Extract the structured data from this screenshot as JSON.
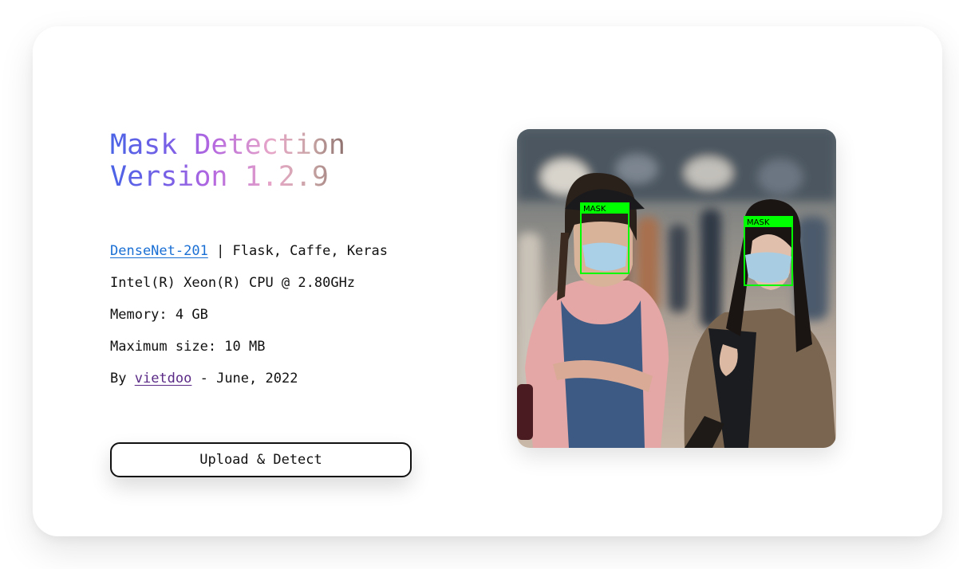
{
  "header": {
    "title_line1": "Mask Detection",
    "title_line2": "Version 1.2.9"
  },
  "specs": {
    "model_link": "DenseNet-201",
    "frameworks": " | Flask, Caffe, Keras",
    "cpu": "Intel(R) Xeon(R) CPU @ 2.80GHz",
    "memory": "Memory: 4 GB",
    "max_size": "Maximum size: 10 MB",
    "by_prefix": "By ",
    "author": "vietdoo",
    "date_suffix": " - June, 2022"
  },
  "actions": {
    "upload_label": "Upload & Detect"
  },
  "detections": [
    {
      "label": "MASK"
    },
    {
      "label": "MASK"
    }
  ],
  "colors": {
    "box": "#00ff00",
    "link": "#1a6fd4",
    "author_link": "#5a2a86",
    "text": "#111111"
  }
}
